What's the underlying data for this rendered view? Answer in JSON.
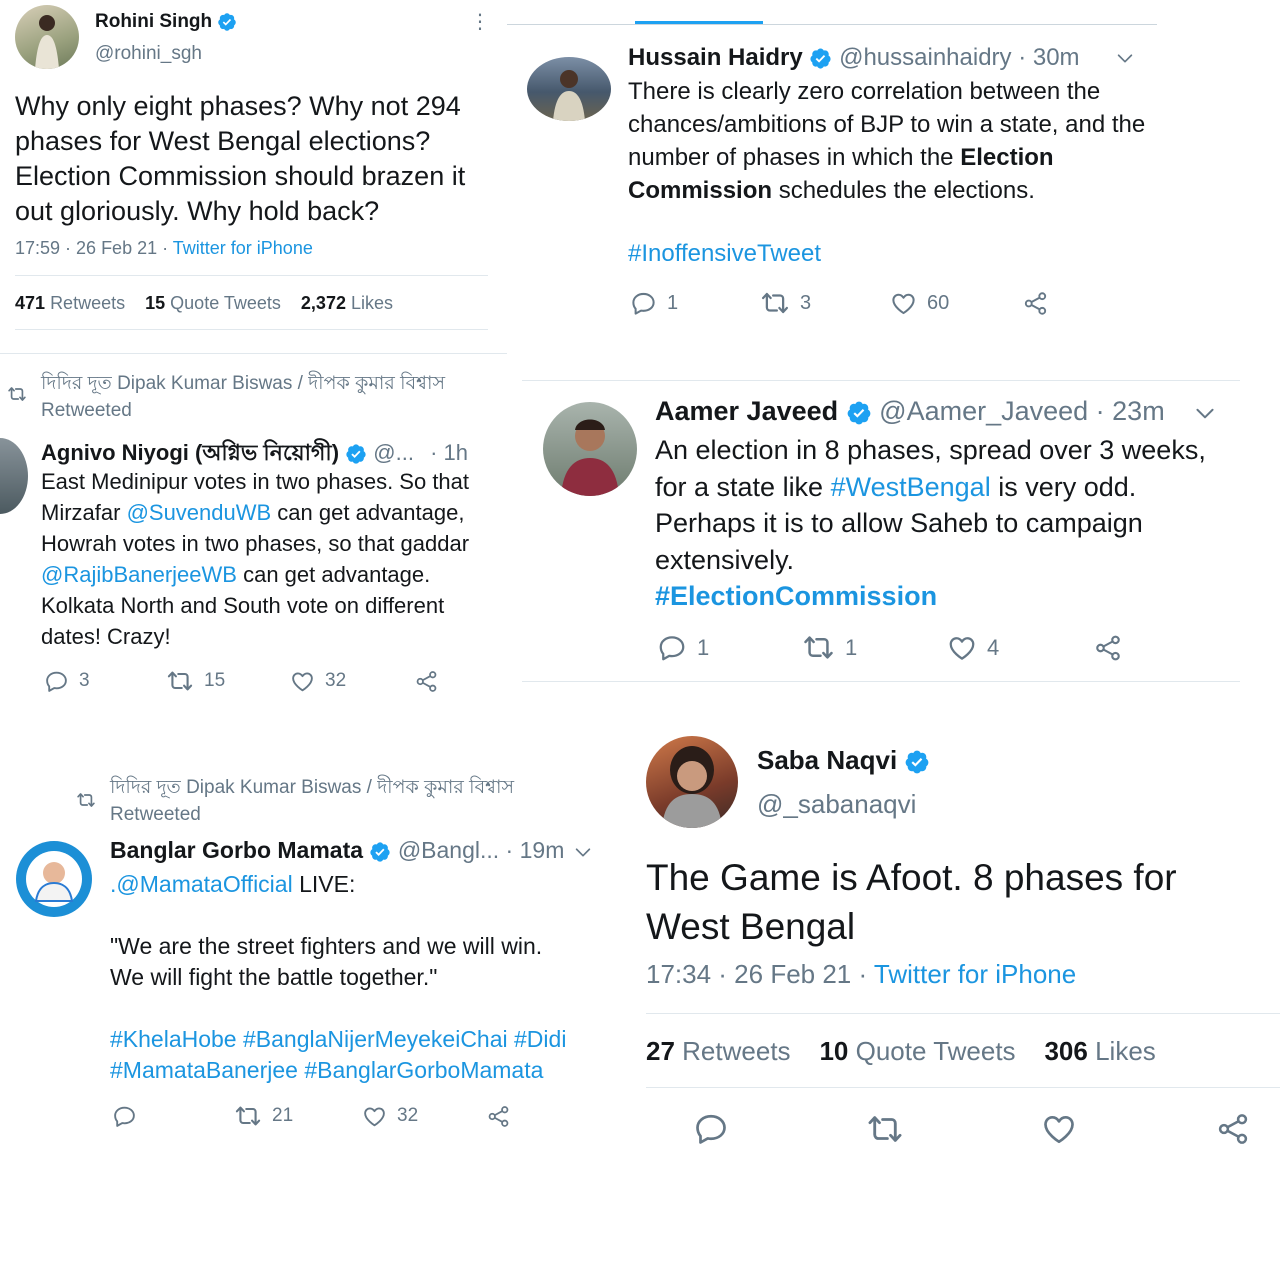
{
  "t1": {
    "name": "Rohini Singh",
    "handle": "@rohini_sgh",
    "text": "Why only eight phases? Why not 294 phases for West Bengal elections? Election Commission should brazen it out gloriously. Why hold back?",
    "time": "17:59 · 26 Feb 21 · ",
    "source": "Twitter for iPhone",
    "retweets": "471",
    "retweets_label": "Retweets",
    "quotes": "15",
    "quotes_label": "Quote Tweets",
    "likes": "2,372",
    "likes_label": "Likes"
  },
  "t2": {
    "name": "Hussain Haidry",
    "handle": "@hussainhaidry · 30m",
    "text_a": "There is clearly zero correlation between the chances/ambitions of BJP to win a state, and the number of phases in which the ",
    "text_bold1": "Election Commission",
    "text_b": " schedules the elections.",
    "hashtag": "#InoffensiveTweet",
    "replies": "1",
    "retweets": "3",
    "likes": "60"
  },
  "t3": {
    "retweeted_by": "দিদির দূত Dipak Kumar Biswas / দীপক কুমার বিশ্বাস",
    "retweeted_label": "Retweeted",
    "name": "Agnivo Niyogi (অগ্নিভ নিয়োগী)",
    "handle": "@...",
    "time": "· 1h",
    "line1": "East Medinipur votes in two phases. So that",
    "line2a": "Mirzafar ",
    "mention1": "@SuvenduWB",
    "line2b": " can get advantage,",
    "line3": "Howrah votes in two phases, so that gaddar",
    "mention2": "@RajibBanerjeeWB",
    "line4b": " can get advantage.",
    "line5": "Kolkata North and South vote on different",
    "line6": "dates! Crazy!",
    "replies": "3",
    "retweets": "15",
    "likes": "32"
  },
  "t4": {
    "name": "Aamer Javeed",
    "handle": "@Aamer_Javeed · 23m",
    "line1": "An election in 8 phases, spread over 3 weeks,",
    "line2a": "for a state like ",
    "hashtag1": "#WestBengal",
    "line2b": " is very odd.",
    "line3": "Perhaps it is to allow Saheb to campaign",
    "line4": "extensively.",
    "hashtag2": "#ElectionCommission",
    "replies": "1",
    "retweets": "1",
    "likes": "4"
  },
  "t5": {
    "retweeted_by": "দিদির দূত Dipak Kumar Biswas / দীপক কুমার বিশ্বাস",
    "retweeted_label": "Retweeted",
    "name": "Banglar Gorbo Mamata",
    "handle": "@Bangl... · 19m",
    "mention": ".@MamataOfficial",
    "live": " LIVE:",
    "quote1": "\"We are the street fighters and we will win.",
    "quote2": "We will fight the battle together.\"",
    "hashtags1": "#KhelaHobe #BanglaNijerMeyekeiChai #Didi",
    "hashtags2": "#MamataBanerjee #BanglarGorboMamata",
    "retweets": "21",
    "likes": "32"
  },
  "t6": {
    "name": "Saba Naqvi",
    "handle": "@_sabanaqvi",
    "text": "The Game is Afoot. 8 phases for West Bengal",
    "time": "17:34 · 26 Feb 21 · ",
    "source": "Twitter for iPhone",
    "retweets": "27",
    "retweets_label": "Retweets",
    "quotes": "10",
    "quotes_label": "Quote Tweets",
    "likes": "306",
    "likes_label": "Likes"
  },
  "colors": {
    "link": "#1b95e0",
    "muted": "#657786",
    "divider": "#e1e8ed",
    "text": "#14171a"
  }
}
